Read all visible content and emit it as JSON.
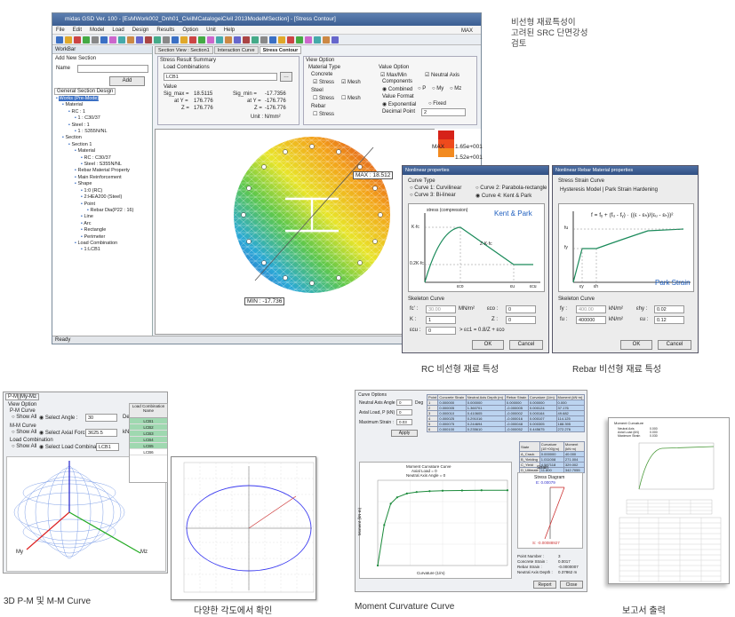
{
  "main_window": {
    "title": "midas GSD Ver. 100 - [EsMWork002_Dnh01_CivilMCatalogeiCivil 2013ModelMSection] - [Stress Contour]",
    "menu": [
      "File",
      "Edit",
      "Model",
      "Load",
      "Design",
      "Results",
      "Option",
      "Unit",
      "Help"
    ],
    "workbar_label": "WorkBar",
    "add_new_section": "Add New Section",
    "name_label": "Name",
    "add_button": "Add",
    "general_tab": "General Section Design",
    "tree": [
      "Works (Pre-Mode)",
      "Material",
      "RC : 1",
      "1 : C30/37",
      "Steel : 1",
      "1 : S355N/NL",
      "Section",
      "Section 1",
      "Material",
      "RC : C30/37",
      "Steel : S355N/NL",
      "Rebar Material Property",
      "Main Reinforcement",
      "Shape",
      "1:0 (RC)",
      "2:HEA200 (Steel)",
      "Point",
      "Rebar Dia(P22 : 16)",
      "Line",
      "Arc",
      "Rectangle",
      "Perimeter",
      "Load Combination",
      "1:LCB1"
    ],
    "tabs": [
      "Section View : Section1",
      "Interaction Curve",
      "Stress Contour"
    ],
    "status": "Ready"
  },
  "stress_summary": {
    "header": "Stress Result Summary",
    "load_comb_label": "Load Combinations",
    "load_comb_value": "LCB1",
    "value_label": "Value",
    "sig_max_label": "Sig_max =",
    "sig_max": "18.5115",
    "sig_min_label": "Sig_min =",
    "sig_min": "-17.7356",
    "at_y_label": "at Y =",
    "y1": "176.776",
    "y2": "-176.776",
    "z_label": "Z =",
    "z1": "176.776",
    "z2": "-176.776",
    "unit": "Unit : N/mm²"
  },
  "view_option": {
    "header": "View Option",
    "material_type": "Material Type",
    "concrete": "Concrete",
    "stress": "Stress",
    "mesh": "Mesh",
    "steel": "Steel",
    "rebar": "Rebar",
    "value_option": "Value Option",
    "max_min": "Max/Min",
    "neutral_axis": "Neutral Axis",
    "components": "Components",
    "combined": "Combined",
    "p": "P",
    "my": "My",
    "mz": "Mz",
    "value_format": "Value Format",
    "exponential": "Exponential",
    "fixed": "Fixed",
    "decimal_point": "Decimal Point",
    "decimal_value": "2"
  },
  "contour": {
    "max_label": "MAX : 18.512",
    "min_label": "MIN : -17.736",
    "legend_max": "MAX",
    "legend_v1": "1.65e+001",
    "legend_v2": "1.52e+001"
  },
  "rc_dialog": {
    "title": "Nonlinear properties",
    "curve_type": "Curve Type",
    "c1": "Curve 1: Curvilinear",
    "c2": "Curve 2: Parabola-rectangle",
    "c3": "Curve 3: Bi-linear",
    "c4": "Curve 4: Kent & Park",
    "chart_title": "Kent & Park",
    "stress_axis": "stress (compression)",
    "k_fc": "K·fc",
    "pt2": "Z·K·fc",
    "pt3": "0.2K·fc",
    "e_co": "εco",
    "e_u": "εu",
    "e_cu": "εcu",
    "skeleton": "Skeleton Curve",
    "fc_label": "fc' :",
    "fc_val": "30.00",
    "fc_unit": "MN/m²",
    "eco_label": "εco :",
    "eco_val": "0",
    "k_label": "K :",
    "k_val": "1",
    "z_label": "Z :",
    "z_val": "0",
    "ecu_label": "εcu :",
    "ecu_val": "0",
    "ecu_note": "> εc1 = 0.8/Z + εco",
    "ok": "OK",
    "cancel": "Cancel"
  },
  "rebar_dialog": {
    "title": "Nonlinear Rebar Material properties",
    "stress_strain": "Stress Strain Curve",
    "model": "Hysteresis Model | Park Strain Hardening",
    "formula": "f = fᵧ + (fᵤ - fᵧ) · ((ε - εₕ)/(εᵤ - εₕ))²",
    "chart_title": "Park Strain",
    "fy": "fy",
    "fu": "fu",
    "ey": "εy",
    "eh": "εh",
    "eu": "εu",
    "skeleton": "Skeleton Curve",
    "fy_label": "fy :",
    "fy_val": "400.00",
    "fy_unit": "kN/m²",
    "ey_label": "εhy :",
    "ey_val": "0.02",
    "fu_label": "fu :",
    "fu_val": "400000",
    "fu_unit": "kN/m²",
    "eu_label": "εu :",
    "eu_val": "0.12",
    "ok": "OK",
    "cancel": "Cancel"
  },
  "captions": {
    "side_line1": "비선형 재료특성이",
    "side_line2": "고려된 SRC 단면강성",
    "side_line3": "검토",
    "rc": "RC 비선형 재료 특성",
    "rebar": "Rebar 비선형 재료 특성",
    "pm_3d": "3D P-M 및 M-M Curve",
    "angles": "다양한 각도에서 확인",
    "moment": "Moment Curvature Curve",
    "report": "보고서 출력"
  },
  "pm_panel": {
    "tab1": "P-M",
    "tab2": "My-Mz",
    "view_option": "View Option",
    "pm_curve": "P-M Curve",
    "show_all": "Show All",
    "select_angle": "Select Angle :",
    "angle_val": "30",
    "deg": "Deg",
    "mm_curve": "M-M Curve",
    "select_axial": "Select Axial Force :",
    "axial_val": "3625.5",
    "kn": "kN",
    "load_comb": "Load Combination",
    "select_lc": "Select Load Combination",
    "lc_val": "LCB1",
    "lc_header": "Load Combination Name",
    "lc_rows": [
      "LCB1",
      "LCB2",
      "LCB3",
      "LCB4",
      "LCB5",
      "LCB6"
    ],
    "ax_my": "My",
    "ax_mz": "Mz",
    "ax_p": "P"
  },
  "mc_panel": {
    "curve_options": "Curve Options",
    "neutral_angle": "Neutral Axis Angle :",
    "na_val": "0",
    "deg": "Deg",
    "axial_load": "Axial Load, P (kN) :",
    "al_val": "0",
    "max_strain": "Maximum Strain :",
    "ms_val": "0.03",
    "apply": "Apply",
    "table_headers": [
      "Point",
      "Concrete Strain",
      "Neutral Axis Depth (m)",
      "Rebar Strain",
      "Curvature (1/m)",
      "Moment (kN·m)"
    ],
    "table_rows": [
      [
        "1",
        "0.000000",
        "0.000000",
        "0.000000",
        "0.000000",
        "0.000"
      ],
      [
        "2",
        "0.000005",
        "1.360701",
        "-0.000005",
        "0.000124",
        "37.176"
      ],
      [
        "3",
        "0.000010",
        "0.410605",
        "-0.000002",
        "0.000164",
        "49.682"
      ],
      [
        "4",
        "0.000025",
        "0.291016",
        "-0.000016",
        "0.000107",
        "114.125"
      ],
      [
        "5",
        "0.000075",
        "0.244694",
        "-0.000048",
        "0.000305",
        "188.395"
      ],
      [
        "6",
        "0.000100",
        "0.235610",
        "-0.000052",
        "0.445675",
        "272.276"
      ]
    ],
    "state_headers": [
      "State",
      "Curvature (1E+00)(m)",
      "Moment (kN·m)"
    ],
    "state_rows": [
      [
        "A_Crack",
        "0.000000",
        "40.000"
      ],
      [
        "B_Yielding",
        "1.011008",
        "271.004"
      ],
      [
        "C_Yield",
        "4.587118",
        "329.002"
      ],
      [
        "D_Ultimate",
        "11.800",
        "342.7055"
      ]
    ],
    "chart_title1": "Moment Curvature Curve",
    "chart_title2": "Axial Load = 0",
    "chart_title3": "Neutral Axis Angle = 0",
    "xlabel": "Curvature (1/m)",
    "ylabel": "Moment (kN·m)",
    "strain_label": "Strain",
    "stress_diagram": "Stress Diagram",
    "sd_val": "E: 0.00079",
    "sd_val2": "S: -0.00088927",
    "point_number": "Point Number :",
    "pn_val": "3",
    "concrete_strain": "Concrete Strain :",
    "cs_val": "0.0017",
    "rebar_strain": "Rebar Strain :",
    "rs_val": "-0.0000007",
    "na_depth": "Neutral Axis Depth :",
    "nad_val": "0.37862 m",
    "report": "Report",
    "close": "Close"
  },
  "report": {
    "title": "Moment Curvature",
    "fields": [
      "Neutral Axis",
      "Axial Load (kN)",
      "Maximum Strain"
    ],
    "values": [
      "0.000",
      "0.000",
      "0.030"
    ]
  },
  "chart_data": [
    {
      "type": "line",
      "title": "Moment Curvature Curve",
      "xlabel": "Curvature (1/m)",
      "ylabel": "Moment (kN·m)",
      "x": [
        0,
        0.1,
        0.2,
        0.3,
        0.45,
        0.6,
        0.8,
        1.0,
        1.3,
        1.6,
        2.0
      ],
      "y": [
        0,
        190,
        290,
        320,
        338,
        345,
        349,
        351,
        352,
        353,
        353
      ],
      "xlim": [
        0,
        2.0
      ],
      "ylim": [
        0,
        400
      ]
    }
  ]
}
